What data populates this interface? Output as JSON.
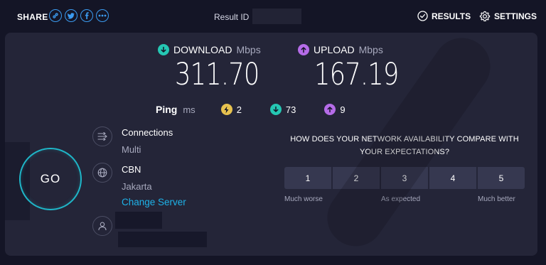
{
  "header": {
    "share_label": "SHARE",
    "share_icons": [
      "link-icon",
      "twitter-icon",
      "facebook-icon",
      "more-icon"
    ],
    "result_id_label": "Result ID",
    "results_label": "RESULTS",
    "settings_label": "SETTINGS"
  },
  "download": {
    "label": "DOWNLOAD",
    "unit": "Mbps",
    "value": "311.70",
    "color": "#25c7b3"
  },
  "upload": {
    "label": "UPLOAD",
    "unit": "Mbps",
    "value": "167.19",
    "color": "#b56ce8"
  },
  "ping": {
    "label": "Ping",
    "unit": "ms",
    "idle": "2",
    "download": "73",
    "upload": "9",
    "idle_color": "#e7c24f"
  },
  "go_label": "GO",
  "connections": {
    "title": "Connections",
    "value": "Multi"
  },
  "server": {
    "name": "CBN",
    "location": "Jakarta",
    "change_label": "Change Server"
  },
  "survey": {
    "question": "HOW DOES YOUR NETWORK AVAILABILITY COMPARE WITH YOUR EXPECTATIONS?",
    "options": [
      "1",
      "2",
      "3",
      "4",
      "5"
    ],
    "scale_low": "Much worse",
    "scale_mid": "As expected",
    "scale_high": "Much better"
  },
  "colors": {
    "background": "#141526",
    "panel": "#242538",
    "accent": "#1eb2e8",
    "go_ring": "#1fb6c8"
  }
}
